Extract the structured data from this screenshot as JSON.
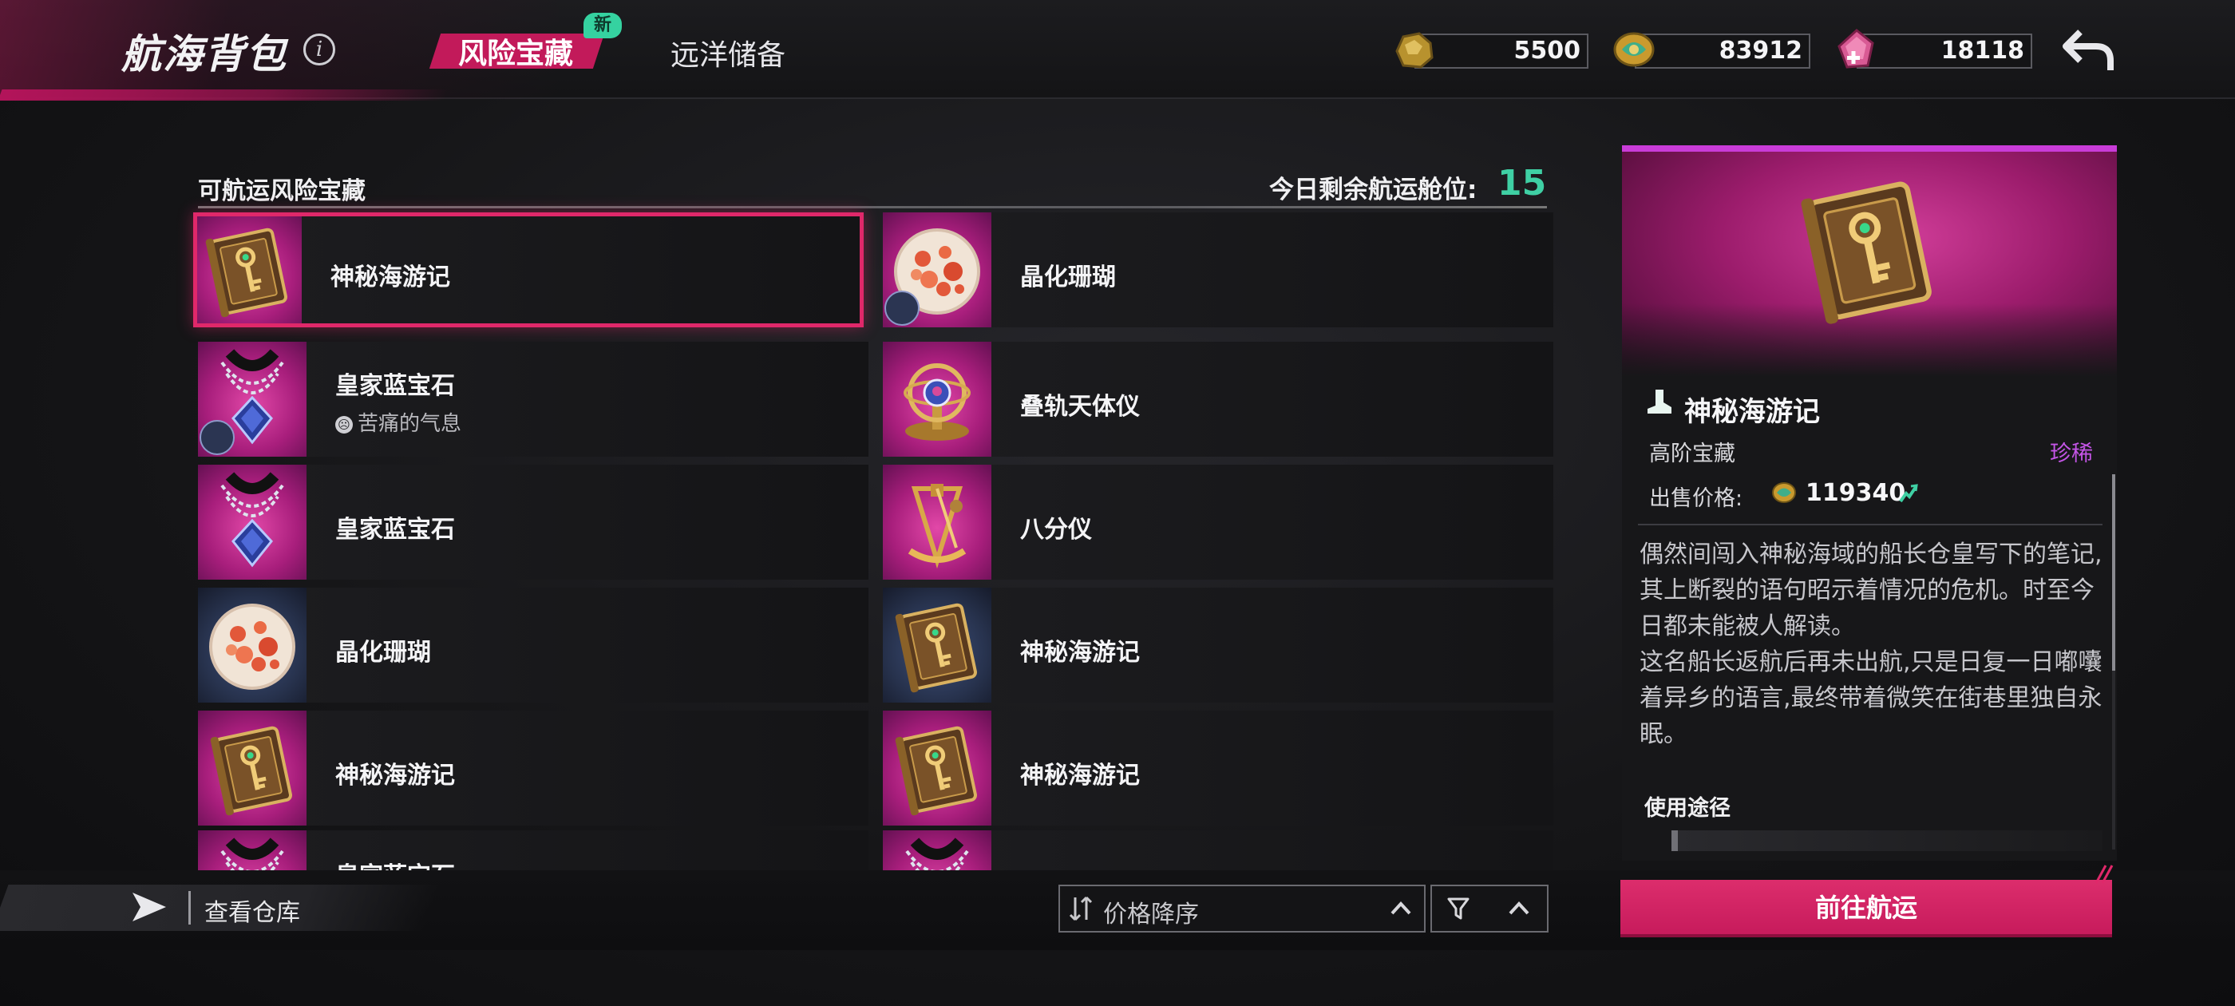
{
  "header": {
    "title": "航海背包",
    "tabs": [
      {
        "label": "风险宝藏",
        "badge": "新",
        "active": true
      },
      {
        "label": "远洋储备",
        "active": false
      }
    ],
    "currencies": [
      {
        "icon": "gold-ore-icon",
        "value": "5500"
      },
      {
        "icon": "dragon-coin-icon",
        "value": "83912"
      },
      {
        "icon": "pink-gem-icon",
        "value": "18118"
      }
    ]
  },
  "list": {
    "title": "可航运风险宝藏",
    "slots_label": "今日剩余航运舱位:",
    "slots_value": "15",
    "items": [
      {
        "name": "神秘海游记",
        "thumb": "book"
      },
      {
        "name": "晶化珊瑚",
        "thumb": "coral"
      },
      {
        "name": "皇家蓝宝石",
        "sub": "苦痛的气息",
        "thumb": "sapphire"
      },
      {
        "name": "叠轨天体仪",
        "thumb": "orrery"
      },
      {
        "name": "皇家蓝宝石",
        "thumb": "sapphire"
      },
      {
        "name": "八分仪",
        "thumb": "octant"
      },
      {
        "name": "晶化珊瑚",
        "thumb": "coral"
      },
      {
        "name": "神秘海游记",
        "thumb": "book"
      },
      {
        "name": "神秘海游记",
        "thumb": "book"
      },
      {
        "name": "神秘海游记",
        "thumb": "book"
      },
      {
        "name": "皇家蓝宝石",
        "thumb": "sapphire"
      },
      {
        "name": "",
        "thumb": "sapphire"
      }
    ]
  },
  "bottom": {
    "warehouse_label": "查看仓库",
    "sort_label": "价格降序"
  },
  "detail": {
    "name": "神秘海游记",
    "tier": "高阶宝藏",
    "rarity": "珍稀",
    "price_label": "出售价格:",
    "price_value": "119340",
    "description": [
      "偶然间闯入神秘海域的船长仓皇写下的笔记,其上断裂的语句昭示着情况的危机。时至今日都未能被人解读。",
      "这名船长返航后再未出航,只是日复一日嘟囔着异乡的语言,最终带着微笑在街巷里独自永眠。"
    ],
    "usage_title": "使用途径",
    "action_label": "前往航运"
  },
  "colors": {
    "accent": "#c21a5a",
    "selection": "#e0286a",
    "slots": "#3fd0a4",
    "rarity": "#c455e6",
    "new_badge": "#35d2a0"
  }
}
